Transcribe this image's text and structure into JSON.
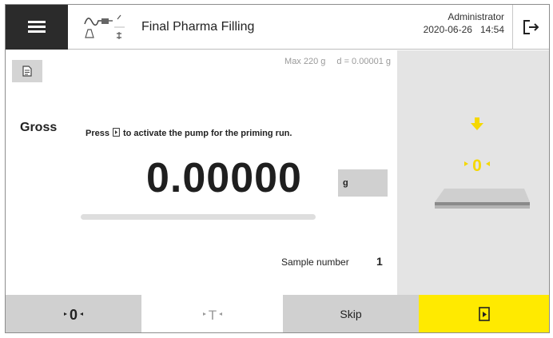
{
  "header": {
    "menu_icon": "hamburger-menu-icon",
    "app_icon": "pharma-filling-icon",
    "title": "Final Pharma Filling",
    "user": "Administrator",
    "date": "2020-06-26",
    "time": "14:54",
    "logout_icon": "logout-icon"
  },
  "scale": {
    "max_capacity": "Max 220 g",
    "readability": "d = 0.00001 g"
  },
  "weighing": {
    "mode": "Gross",
    "instruction_before": "Press",
    "instruction_after": "to activate the pump for the priming run.",
    "value": "0.00000",
    "unit": "g",
    "progress_fraction": 0.0
  },
  "sample": {
    "label": "Sample number",
    "value": "1"
  },
  "toolbar": {
    "zero_label": "0",
    "tare_label": "T",
    "skip_label": "Skip",
    "run_icon": "start-run-icon"
  },
  "colors": {
    "accent_yellow": "#ffea00",
    "indicator_yellow": "#f5d800",
    "menu_dark": "#2b2b2b",
    "button_gray": "#d0d0d0",
    "panel_gray": "#e4e4e4"
  }
}
